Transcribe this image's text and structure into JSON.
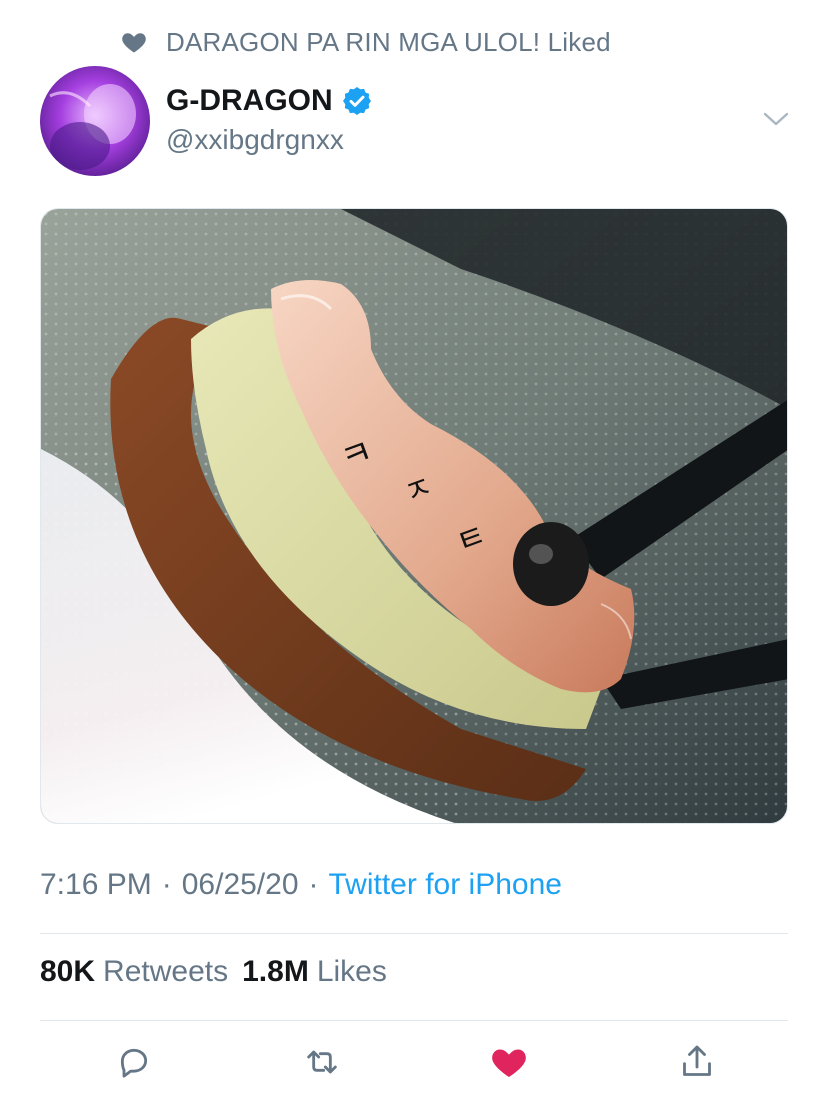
{
  "social_context": {
    "icon": "heart-icon",
    "text": "DARAGON PA RIN MGA ULOL! Liked",
    "color": "#657786"
  },
  "author": {
    "display_name": "G-DRAGON",
    "handle": "@xxibgdrgnxx",
    "verified": true,
    "verified_color": "#1da1f2"
  },
  "tweet": {
    "time": "7:16 PM",
    "separator": "·",
    "date": "06/25/20",
    "source": "Twitter for iPhone",
    "media": "photo"
  },
  "stats": {
    "retweets_count": "80K",
    "retweets_label": "Retweets",
    "likes_count": "1.8M",
    "likes_label": "Likes"
  },
  "actions": [
    {
      "name": "reply",
      "icon": "reply-icon"
    },
    {
      "name": "retweet",
      "icon": "retweet-icon"
    },
    {
      "name": "like",
      "icon": "heart-filled-icon",
      "active": true,
      "color": "#e0245e"
    },
    {
      "name": "share",
      "icon": "share-icon"
    }
  ],
  "colors": {
    "accent": "#1da1f2",
    "secondary_text": "#657786",
    "like": "#e0245e"
  }
}
